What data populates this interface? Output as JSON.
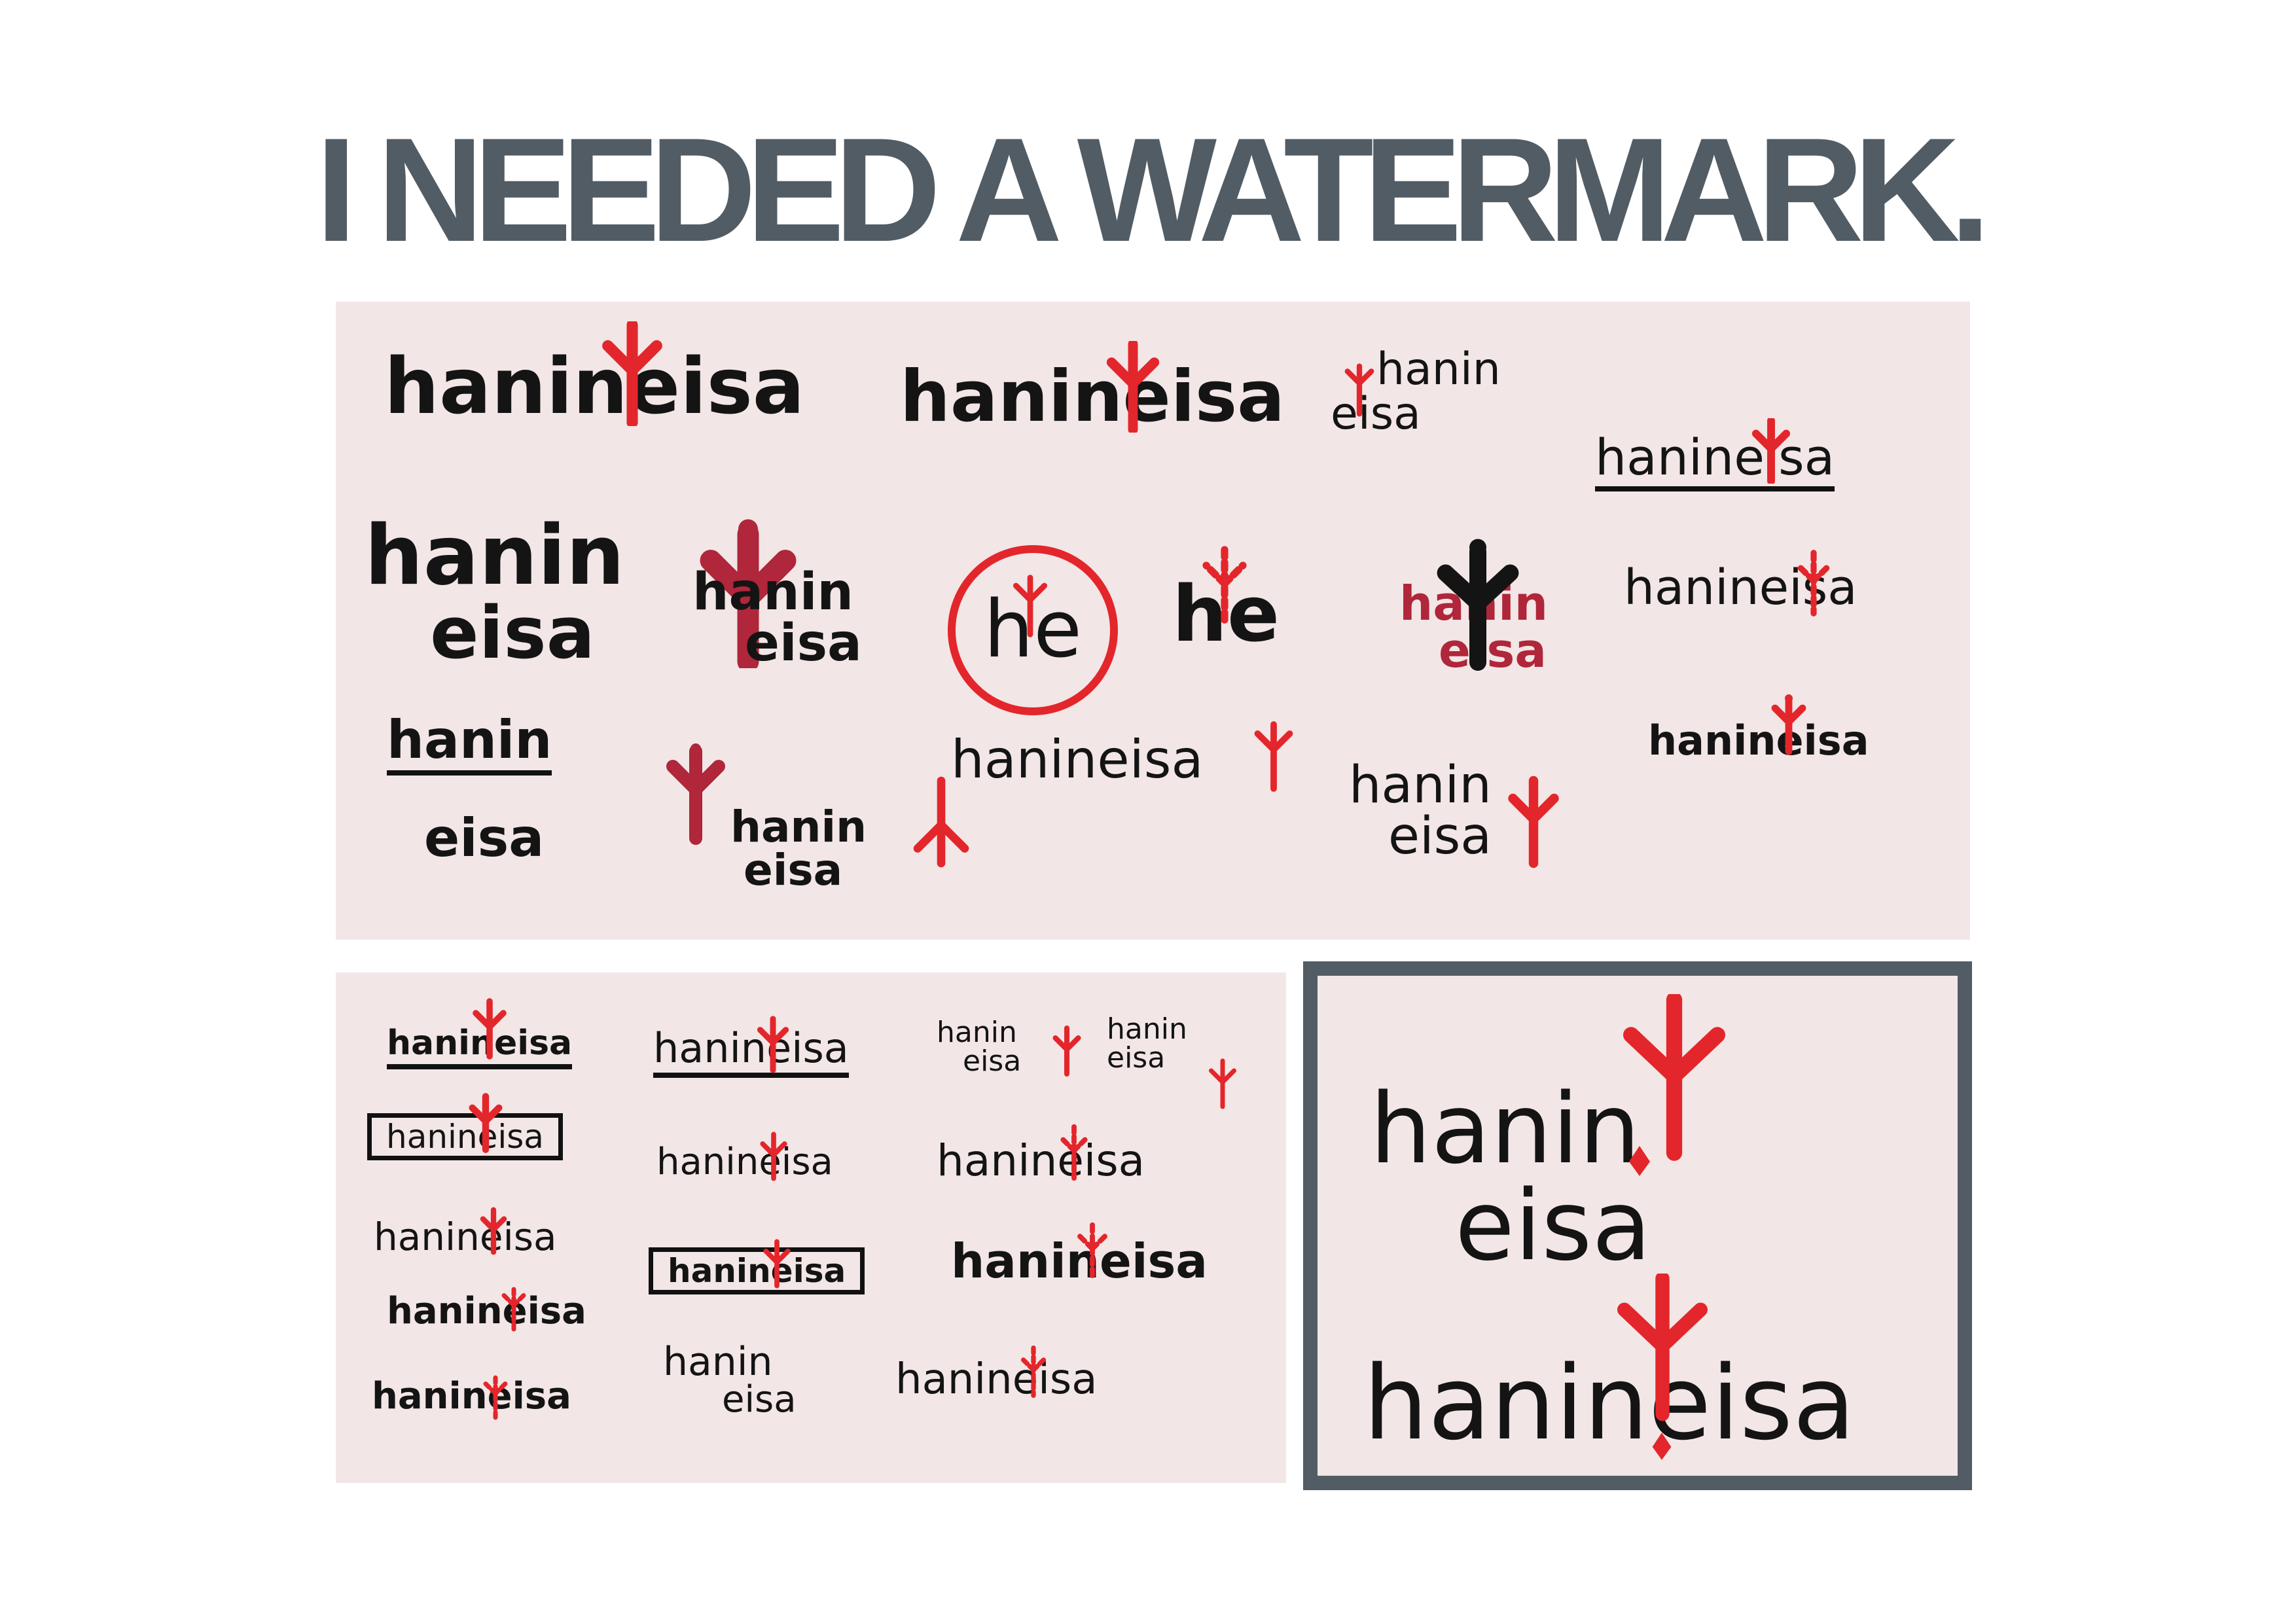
{
  "headline": "I NEEDED A WATERMARK.",
  "colors": {
    "headline": "#525c64",
    "panel": "#f2e6e6",
    "ink": "#141414",
    "accent_red": "#e3262b",
    "frame": "#525c64"
  },
  "icon": "trident-fork-icon",
  "logo_text": {
    "full": "hanineisa",
    "first": "hanin",
    "last": "eisa",
    "initials": "he"
  }
}
